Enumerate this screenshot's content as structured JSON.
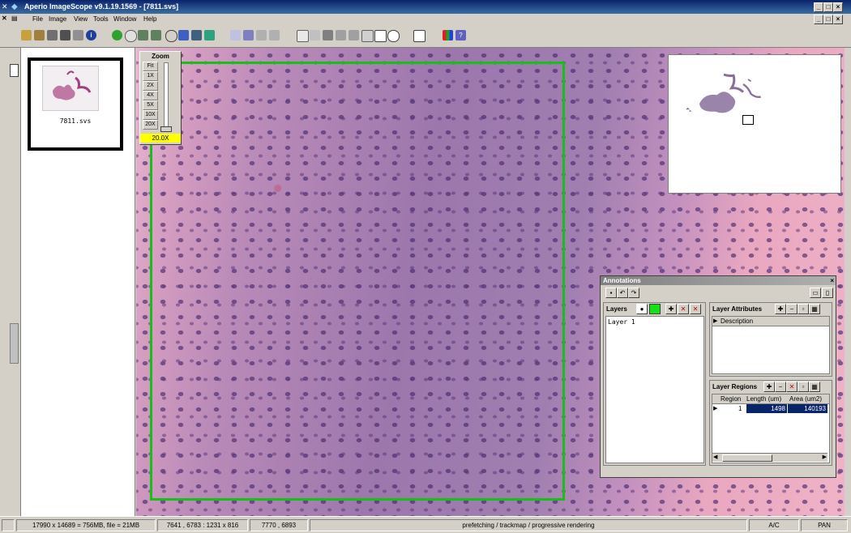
{
  "window": {
    "title": "Aperio ImageScope v9.1.19.1569 - [7811.svs]"
  },
  "menu": {
    "items": [
      "File",
      "Image",
      "View",
      "Tools",
      "Window",
      "Help"
    ]
  },
  "thumbnail": {
    "label": "7811.svs"
  },
  "zoom": {
    "title": "Zoom",
    "buttons": [
      "Fit",
      "1X",
      "2X",
      "4X",
      "5X",
      "10X",
      "20X"
    ],
    "current": "20.0X"
  },
  "annotations": {
    "title": "Annotations",
    "layers": {
      "label": "Layers",
      "items": [
        "Layer 1"
      ]
    },
    "layer_attributes": {
      "label": "Layer Attributes",
      "columns": [
        "Description"
      ]
    },
    "layer_regions": {
      "label": "Layer Regions",
      "columns": [
        "Region",
        "Length (um)",
        "Area (um2)"
      ],
      "rows": [
        {
          "region": "1",
          "length": "1498",
          "area": "140193"
        }
      ]
    }
  },
  "status": {
    "dims": "17990 x 14689 = 756MB, file = 21MB",
    "viewport": "7641 , 6783 : 1231 x 816",
    "cursor": "7770 , 6893",
    "message": "prefetching / trackmap / progressive rendering",
    "mode1": "A/C",
    "mode2": "PAN"
  },
  "colors": {
    "roi": "#16c016",
    "title_bar": "#0a246a",
    "zoom_highlight": "#ffff00",
    "selection": "#0a246a"
  }
}
